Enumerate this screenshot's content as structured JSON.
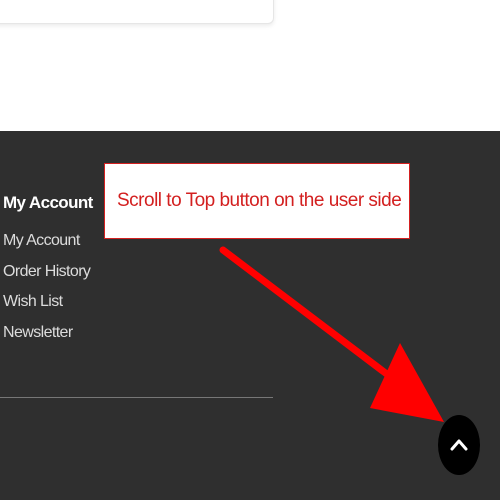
{
  "footer": {
    "account_heading": "My Account",
    "links": [
      "My Account",
      "Order History",
      "Wish List",
      "Newsletter"
    ]
  },
  "annotation": {
    "text": "Scroll to Top button on the user side",
    "color": "#d32020"
  },
  "scroll_top": {
    "icon": "chevron-up-icon",
    "background": "#000000"
  }
}
